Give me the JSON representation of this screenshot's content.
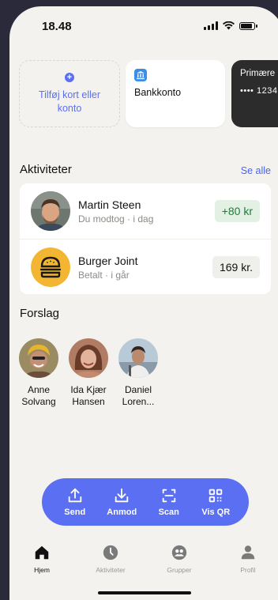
{
  "status": {
    "time": "18.48"
  },
  "cards": {
    "add_label": "Tilføj kort eller konto",
    "bank_label": "Bankkonto",
    "primary_label": "Primære",
    "primary_number": "•••• 1234"
  },
  "activity": {
    "title": "Aktiviteter",
    "see_all": "Se alle",
    "items": [
      {
        "name": "Martin Steen",
        "subtitle": "Du modtog · i dag",
        "amount": "+80 kr"
      },
      {
        "name": "Burger Joint",
        "subtitle": "Betalt · i går",
        "amount": "169 kr."
      }
    ]
  },
  "suggestions": {
    "title": "Forslag",
    "people": [
      {
        "name": "Anne Solvang"
      },
      {
        "name": "Ida Kjær Hansen"
      },
      {
        "name": "Daniel Loren..."
      }
    ]
  },
  "actions": [
    {
      "label": "Send",
      "icon": "upload-icon"
    },
    {
      "label": "Anmod",
      "icon": "download-icon"
    },
    {
      "label": "Scan",
      "icon": "scan-icon"
    },
    {
      "label": "Vis QR",
      "icon": "qr-icon"
    }
  ],
  "tabs": [
    {
      "label": "Hjem",
      "icon": "home-icon",
      "active": true
    },
    {
      "label": "Aktiviteter",
      "icon": "clock-icon",
      "active": false
    },
    {
      "label": "Grupper",
      "icon": "group-icon",
      "active": false
    },
    {
      "label": "Profil",
      "icon": "person-icon",
      "active": false
    }
  ],
  "colors": {
    "accent": "#5a6ff2",
    "positive": "#1f7a3a",
    "background": "#f3f2ee"
  }
}
